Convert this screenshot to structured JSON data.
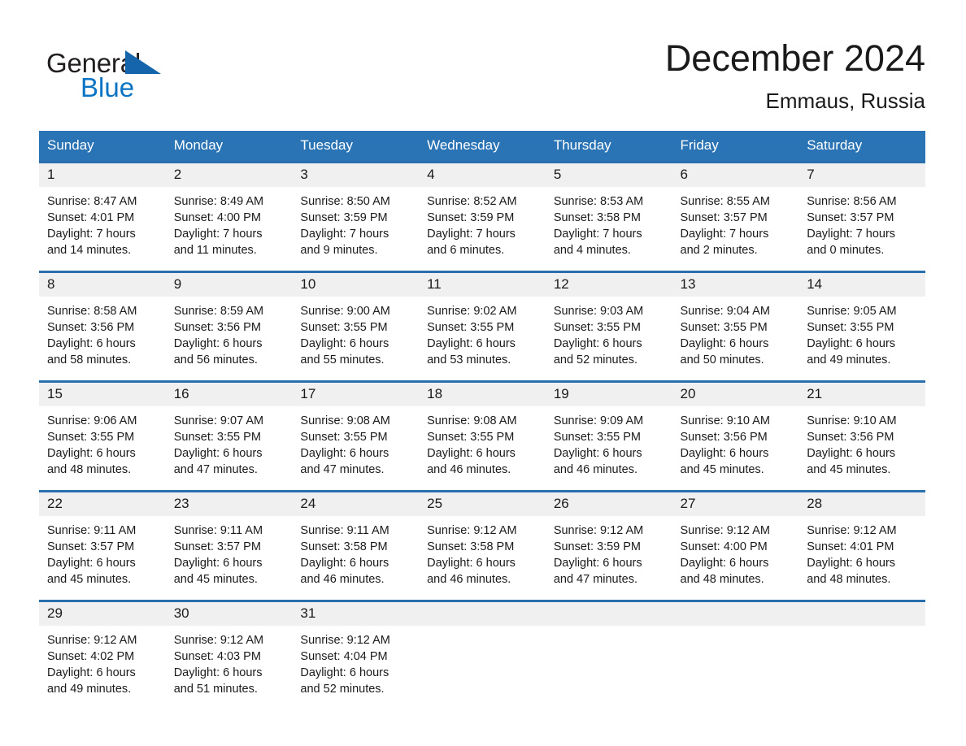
{
  "brand": {
    "name_part1": "General",
    "name_part2": "Blue",
    "triangle_color": "#1565ac",
    "blue_color": "#0a74c4"
  },
  "header": {
    "month_title": "December 2024",
    "location": "Emmaus, Russia"
  },
  "theme": {
    "header_blue": "#2a74b5",
    "rule_blue": "#2a6fad",
    "daynum_bg": "#f0f0f0"
  },
  "calendar": {
    "weekday_headers": [
      "Sunday",
      "Monday",
      "Tuesday",
      "Wednesday",
      "Thursday",
      "Friday",
      "Saturday"
    ],
    "weeks": [
      [
        {
          "day": "1",
          "sunrise": "Sunrise: 8:47 AM",
          "sunset": "Sunset: 4:01 PM",
          "daylight1": "Daylight: 7 hours",
          "daylight2": "and 14 minutes."
        },
        {
          "day": "2",
          "sunrise": "Sunrise: 8:49 AM",
          "sunset": "Sunset: 4:00 PM",
          "daylight1": "Daylight: 7 hours",
          "daylight2": "and 11 minutes."
        },
        {
          "day": "3",
          "sunrise": "Sunrise: 8:50 AM",
          "sunset": "Sunset: 3:59 PM",
          "daylight1": "Daylight: 7 hours",
          "daylight2": "and 9 minutes."
        },
        {
          "day": "4",
          "sunrise": "Sunrise: 8:52 AM",
          "sunset": "Sunset: 3:59 PM",
          "daylight1": "Daylight: 7 hours",
          "daylight2": "and 6 minutes."
        },
        {
          "day": "5",
          "sunrise": "Sunrise: 8:53 AM",
          "sunset": "Sunset: 3:58 PM",
          "daylight1": "Daylight: 7 hours",
          "daylight2": "and 4 minutes."
        },
        {
          "day": "6",
          "sunrise": "Sunrise: 8:55 AM",
          "sunset": "Sunset: 3:57 PM",
          "daylight1": "Daylight: 7 hours",
          "daylight2": "and 2 minutes."
        },
        {
          "day": "7",
          "sunrise": "Sunrise: 8:56 AM",
          "sunset": "Sunset: 3:57 PM",
          "daylight1": "Daylight: 7 hours",
          "daylight2": "and 0 minutes."
        }
      ],
      [
        {
          "day": "8",
          "sunrise": "Sunrise: 8:58 AM",
          "sunset": "Sunset: 3:56 PM",
          "daylight1": "Daylight: 6 hours",
          "daylight2": "and 58 minutes."
        },
        {
          "day": "9",
          "sunrise": "Sunrise: 8:59 AM",
          "sunset": "Sunset: 3:56 PM",
          "daylight1": "Daylight: 6 hours",
          "daylight2": "and 56 minutes."
        },
        {
          "day": "10",
          "sunrise": "Sunrise: 9:00 AM",
          "sunset": "Sunset: 3:55 PM",
          "daylight1": "Daylight: 6 hours",
          "daylight2": "and 55 minutes."
        },
        {
          "day": "11",
          "sunrise": "Sunrise: 9:02 AM",
          "sunset": "Sunset: 3:55 PM",
          "daylight1": "Daylight: 6 hours",
          "daylight2": "and 53 minutes."
        },
        {
          "day": "12",
          "sunrise": "Sunrise: 9:03 AM",
          "sunset": "Sunset: 3:55 PM",
          "daylight1": "Daylight: 6 hours",
          "daylight2": "and 52 minutes."
        },
        {
          "day": "13",
          "sunrise": "Sunrise: 9:04 AM",
          "sunset": "Sunset: 3:55 PM",
          "daylight1": "Daylight: 6 hours",
          "daylight2": "and 50 minutes."
        },
        {
          "day": "14",
          "sunrise": "Sunrise: 9:05 AM",
          "sunset": "Sunset: 3:55 PM",
          "daylight1": "Daylight: 6 hours",
          "daylight2": "and 49 minutes."
        }
      ],
      [
        {
          "day": "15",
          "sunrise": "Sunrise: 9:06 AM",
          "sunset": "Sunset: 3:55 PM",
          "daylight1": "Daylight: 6 hours",
          "daylight2": "and 48 minutes."
        },
        {
          "day": "16",
          "sunrise": "Sunrise: 9:07 AM",
          "sunset": "Sunset: 3:55 PM",
          "daylight1": "Daylight: 6 hours",
          "daylight2": "and 47 minutes."
        },
        {
          "day": "17",
          "sunrise": "Sunrise: 9:08 AM",
          "sunset": "Sunset: 3:55 PM",
          "daylight1": "Daylight: 6 hours",
          "daylight2": "and 47 minutes."
        },
        {
          "day": "18",
          "sunrise": "Sunrise: 9:08 AM",
          "sunset": "Sunset: 3:55 PM",
          "daylight1": "Daylight: 6 hours",
          "daylight2": "and 46 minutes."
        },
        {
          "day": "19",
          "sunrise": "Sunrise: 9:09 AM",
          "sunset": "Sunset: 3:55 PM",
          "daylight1": "Daylight: 6 hours",
          "daylight2": "and 46 minutes."
        },
        {
          "day": "20",
          "sunrise": "Sunrise: 9:10 AM",
          "sunset": "Sunset: 3:56 PM",
          "daylight1": "Daylight: 6 hours",
          "daylight2": "and 45 minutes."
        },
        {
          "day": "21",
          "sunrise": "Sunrise: 9:10 AM",
          "sunset": "Sunset: 3:56 PM",
          "daylight1": "Daylight: 6 hours",
          "daylight2": "and 45 minutes."
        }
      ],
      [
        {
          "day": "22",
          "sunrise": "Sunrise: 9:11 AM",
          "sunset": "Sunset: 3:57 PM",
          "daylight1": "Daylight: 6 hours",
          "daylight2": "and 45 minutes."
        },
        {
          "day": "23",
          "sunrise": "Sunrise: 9:11 AM",
          "sunset": "Sunset: 3:57 PM",
          "daylight1": "Daylight: 6 hours",
          "daylight2": "and 45 minutes."
        },
        {
          "day": "24",
          "sunrise": "Sunrise: 9:11 AM",
          "sunset": "Sunset: 3:58 PM",
          "daylight1": "Daylight: 6 hours",
          "daylight2": "and 46 minutes."
        },
        {
          "day": "25",
          "sunrise": "Sunrise: 9:12 AM",
          "sunset": "Sunset: 3:58 PM",
          "daylight1": "Daylight: 6 hours",
          "daylight2": "and 46 minutes."
        },
        {
          "day": "26",
          "sunrise": "Sunrise: 9:12 AM",
          "sunset": "Sunset: 3:59 PM",
          "daylight1": "Daylight: 6 hours",
          "daylight2": "and 47 minutes."
        },
        {
          "day": "27",
          "sunrise": "Sunrise: 9:12 AM",
          "sunset": "Sunset: 4:00 PM",
          "daylight1": "Daylight: 6 hours",
          "daylight2": "and 48 minutes."
        },
        {
          "day": "28",
          "sunrise": "Sunrise: 9:12 AM",
          "sunset": "Sunset: 4:01 PM",
          "daylight1": "Daylight: 6 hours",
          "daylight2": "and 48 minutes."
        }
      ],
      [
        {
          "day": "29",
          "sunrise": "Sunrise: 9:12 AM",
          "sunset": "Sunset: 4:02 PM",
          "daylight1": "Daylight: 6 hours",
          "daylight2": "and 49 minutes."
        },
        {
          "day": "30",
          "sunrise": "Sunrise: 9:12 AM",
          "sunset": "Sunset: 4:03 PM",
          "daylight1": "Daylight: 6 hours",
          "daylight2": "and 51 minutes."
        },
        {
          "day": "31",
          "sunrise": "Sunrise: 9:12 AM",
          "sunset": "Sunset: 4:04 PM",
          "daylight1": "Daylight: 6 hours",
          "daylight2": "and 52 minutes."
        },
        {
          "day": "",
          "sunrise": "",
          "sunset": "",
          "daylight1": "",
          "daylight2": ""
        },
        {
          "day": "",
          "sunrise": "",
          "sunset": "",
          "daylight1": "",
          "daylight2": ""
        },
        {
          "day": "",
          "sunrise": "",
          "sunset": "",
          "daylight1": "",
          "daylight2": ""
        },
        {
          "day": "",
          "sunrise": "",
          "sunset": "",
          "daylight1": "",
          "daylight2": ""
        }
      ]
    ]
  }
}
